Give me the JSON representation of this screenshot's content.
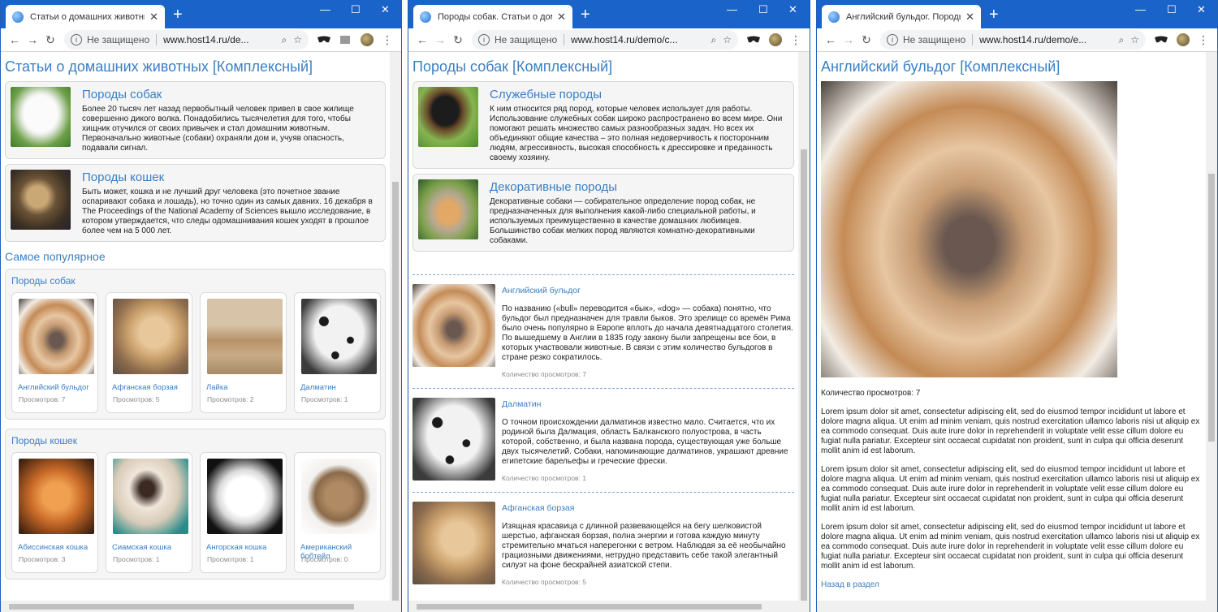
{
  "browser": {
    "insecure_label": "Не защищено"
  },
  "windows": [
    {
      "tab_title": "Статьи о домашних животных",
      "url": "www.host14.ru/de..."
    },
    {
      "tab_title": "Породы собак. Статьи о домаш",
      "url": "www.host14.ru/demo/c..."
    },
    {
      "tab_title": "Английский бульдог. Породы со",
      "url": "www.host14.ru/demo/e..."
    }
  ],
  "page1": {
    "title": "Статьи о домашних животных [Комплексный]",
    "sections": [
      {
        "title": "Породы собак",
        "text": "Более 20 тысяч лет назад первобытный человек привел в свое жилище совершенно дикого волка. Понадобились тысячелетия для того, чтобы хищник отучился от своих привычек и стал домашним животным. Первоначально животные (собаки) охраняли дом и, учуяв опасность, подавали сигнал."
      },
      {
        "title": "Породы кошек",
        "text": "Быть может, кошка и не лучший друг человека (это почетное звание оспаривают собака и лошадь), но точно один из самых давних. 16 декабря в The Proceedings of the National Academy of Sciences вышло исследование, в котором утверждается, что следы одомашнивания кошек уходят в прошлое более чем на 5 000 лет."
      }
    ],
    "popular_title": "Самое популярное",
    "groups": [
      {
        "title": "Породы собак",
        "items": [
          {
            "name": "Английский бульдог",
            "views": "Просмотров: 7"
          },
          {
            "name": "Афганская борзая",
            "views": "Просмотров: 5"
          },
          {
            "name": "Лайка",
            "views": "Просмотров: 2"
          },
          {
            "name": "Далматин",
            "views": "Просмотров: 1"
          }
        ]
      },
      {
        "title": "Породы кошек",
        "items": [
          {
            "name": "Абиссинская кошка",
            "views": "Просмотров: 3"
          },
          {
            "name": "Сиамская кошка",
            "views": "Просмотров: 1"
          },
          {
            "name": "Ангорская кошка",
            "views": "Просмотров: 1"
          },
          {
            "name": "Американский бобтейл",
            "views": "Просмотров: 0"
          }
        ]
      }
    ]
  },
  "page2": {
    "title": "Породы собак [Комплексный]",
    "sections": [
      {
        "title": "Служебные породы",
        "text": "К ним относится ряд пород, которые человек использует для работы. Использование служебных собак широко распространено во всем мире. Они помогают решать множество самых разнообразных задач. Но всех их объединяют общие качества – это полная недоверчивость к посторонним людям, агрессивность, высокая способность к дрессировке и преданность своему хозяину."
      },
      {
        "title": "Декоративные породы",
        "text": "Декоративные собаки — собирательное определение пород собак, не предназначенных для выполнения какой-либо специальной работы, и используемых преимущественно в качестве домашних любимцев. Большинство собак мелких пород являются комнатно-декоративными собаками."
      }
    ],
    "articles": [
      {
        "title": "Английский бульдог",
        "text": "По названию («bull» переводится «бык», «dog» — собака) понятно, что бульдог был предназначен для травли быков. Это зрелище со времён Рима было очень популярно в Европе вплоть до начала девятнадцатого столетия. По вышедшему в Англии в 1835 году закону были запрещены все бои, в которых участвовали животные. В связи с этим количество бульдогов в стране резко сократилось.",
        "count": "Количество просмотров: 7"
      },
      {
        "title": "Далматин",
        "text": "О точном происхождении далматинов известно мало. Считается, что их родиной была Далмация, область Балканского полуострова, в часть которой, собственно, и была названа порода, существующая уже больше двух тысячелетий. Собаки, напоминающие далматинов, украшают древние египетские барельефы и греческие фрески.",
        "count": "Количество просмотров: 1"
      },
      {
        "title": "Афганская борзая",
        "text": "Изящная красавица с длинной развевающейся на бегу шелковистой шерстью, афганская борзая, полна энергии и готова каждую минуту стремительно мчаться наперегонки с ветром. Наблюдая за её необычайно грациозными движениями, нетрудно представить себе такой элегантный силуэт на фоне бескрайней азиатской степи.",
        "count": "Количество просмотров: 5"
      }
    ]
  },
  "page3": {
    "title": "Английский бульдог [Комплексный]",
    "views": "Количество просмотров: 7",
    "paragraphs": [
      "Lorem ipsum dolor sit amet, consectetur adipiscing elit, sed do eiusmod tempor incididunt ut labore et dolore magna aliqua. Ut enim ad minim veniam, quis nostrud exercitation ullamco laboris nisi ut aliquip ex ea commodo consequat. Duis aute irure dolor in reprehenderit in voluptate velit esse cillum dolore eu fugiat nulla pariatur. Excepteur sint occaecat cupidatat non proident, sunt in culpa qui officia deserunt mollit anim id est laborum.",
      "Lorem ipsum dolor sit amet, consectetur adipiscing elit, sed do eiusmod tempor incididunt ut labore et dolore magna aliqua. Ut enim ad minim veniam, quis nostrud exercitation ullamco laboris nisi ut aliquip ex ea commodo consequat. Duis aute irure dolor in reprehenderit in voluptate velit esse cillum dolore eu fugiat nulla pariatur. Excepteur sint occaecat cupidatat non proident, sunt in culpa qui officia deserunt mollit anim id est laborum.",
      "Lorem ipsum dolor sit amet, consectetur adipiscing elit, sed do eiusmod tempor incididunt ut labore et dolore magna aliqua. Ut enim ad minim veniam, quis nostrud exercitation ullamco laboris nisi ut aliquip ex ea commodo consequat. Duis aute irure dolor in reprehenderit in voluptate velit esse cillum dolore eu fugiat nulla pariatur. Excepteur sint occaecat cupidatat non proident, sunt in culpa qui officia deserunt mollit anim id est laborum."
    ],
    "back_link": "Назад в раздел"
  },
  "icons": {
    "back": "arrow-left-icon",
    "forward": "arrow-right-icon",
    "reload": "reload-icon",
    "info": "info-icon",
    "zoom": "search-icon",
    "bookmark": "star-icon",
    "menu": "kebab-menu-icon",
    "close_tab": "close-icon",
    "new_tab": "plus-icon",
    "minimize": "minimize-icon",
    "maximize": "maximize-icon",
    "close_window": "close-icon"
  },
  "colors": {
    "titlebar": "#1a63c9",
    "link": "#3a7fc4",
    "card_bg": "#f5f5f5",
    "muted": "#8a8a8a"
  }
}
